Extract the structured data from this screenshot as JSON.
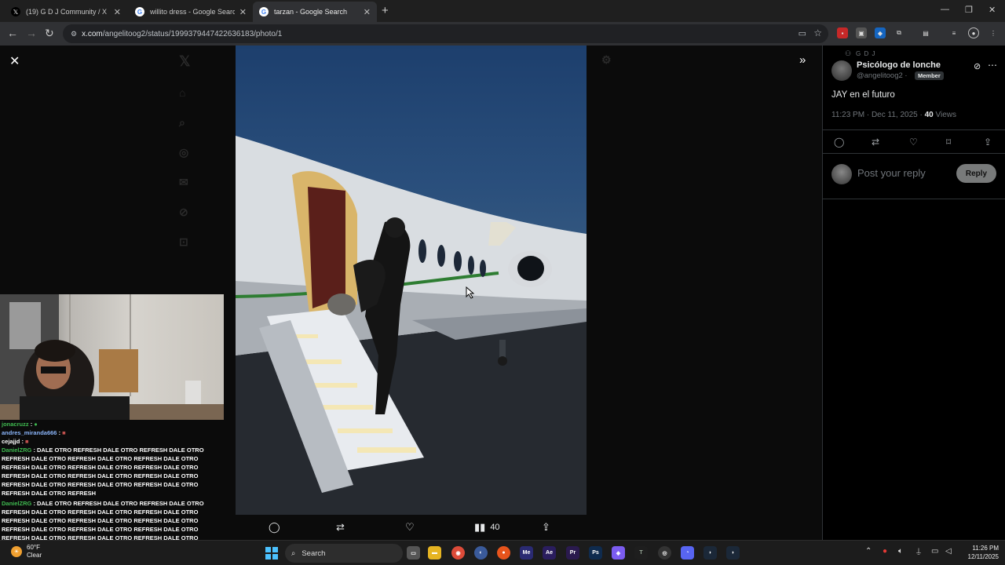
{
  "browser": {
    "tabs": [
      {
        "title": "(19) G D J Community / X",
        "icon": "x-logo-icon",
        "active": false
      },
      {
        "title": "willito dress - Google Search",
        "icon": "google-icon",
        "active": false
      },
      {
        "title": "tarzan - Google Search",
        "icon": "google-icon",
        "active": true
      }
    ],
    "url_domain": "x.com",
    "url_path": "/angelitoog2/status/1999379447422636183/photo/1"
  },
  "viewer": {
    "reply_count": "",
    "views": "40"
  },
  "chat": [
    {
      "user": "jonacruzz",
      "msg": ":"
    },
    {
      "user": "andres_miranda666",
      "msg": ":"
    },
    {
      "user": "cejajjd",
      "msg": ":"
    },
    {
      "user": "DanielZRG",
      "msg": ": DALE OTRO REFRESH DALE OTRO REFRESH DALE OTRO REFRESH DALE OTRO REFRESH DALE OTRO REFRESH DALE OTRO REFRESH DALE OTRO REFRESH DALE OTRO REFRESH DALE OTRO REFRESH DALE OTRO REFRESH DALE OTRO REFRESH DALE OTRO REFRESH DALE OTRO REFRESH DALE OTRO REFRESH DALE OTRO REFRESH DALE OTRO REFRESH"
    },
    {
      "user": "DanielZRG",
      "msg": ": DALE OTRO REFRESH DALE OTRO REFRESH DALE OTRO REFRESH DALE OTRO REFRESH DALE OTRO REFRESH DALE OTRO REFRESH DALE OTRO REFRESH DALE OTRO REFRESH DALE OTRO REFRESH DALE OTRO REFRESH DALE OTRO REFRESH DALE OTRO REFRESH DALE OTRO REFRESH DALE OTRO REFRESH DALE OTRO REFRESH DALE OTRO REFRESH"
    }
  ],
  "post": {
    "community": "G D J",
    "name": "Psicólogo de lonche",
    "handle": "@angelitoog2 ·",
    "badge": "Member",
    "text": "JAY en el futuro",
    "time": "11:23 PM · Dec 11, 2025 ·",
    "views_count": "40",
    "views_label": "Views",
    "reply_placeholder": "Post your reply",
    "reply_button": "Reply"
  },
  "taskbar": {
    "temp": "60°F",
    "condition": "Clear",
    "search_label": "Search",
    "time": "11:26 PM",
    "date": "12/11/2025"
  }
}
